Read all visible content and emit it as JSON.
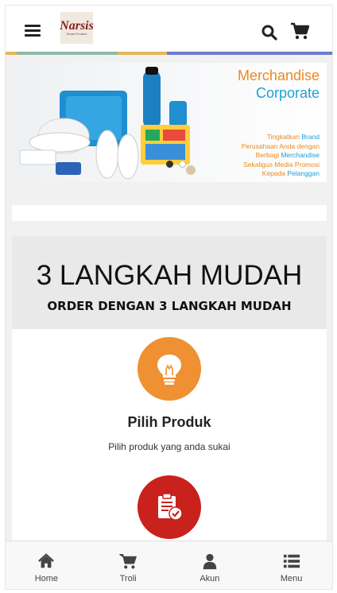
{
  "header": {
    "logo_text": "Narsis",
    "logo_sub": "Smart Product"
  },
  "banner": {
    "title_line1": "Merchandise",
    "title_line2": "Corporate",
    "tagline": [
      {
        "text": "Tingkatkan ",
        "hl": "Brand"
      },
      {
        "text": "Perusahaan Anda dengan",
        "hl": ""
      },
      {
        "text": "Berbagi ",
        "hl": "Merchandise"
      },
      {
        "text": "Sekaligus Media Promosi",
        "hl": ""
      },
      {
        "text": "Kepada ",
        "hl": "Pelanggan"
      }
    ],
    "slides": 2,
    "active_slide": 1
  },
  "steps": {
    "heading": "3 LANGKAH MUDAH",
    "subheading": "ORDER DENGAN 3 LANGKAH MUDAH",
    "items": [
      {
        "title": "Pilih Produk",
        "desc": "Pilih produk yang anda sukai",
        "icon": "lightbulb-icon",
        "color": "#ef9032"
      },
      {
        "title": "",
        "desc": "",
        "icon": "clipboard-check-icon",
        "color": "#c9221c"
      }
    ]
  },
  "bottom_nav": {
    "home": "Home",
    "troli": "Troli",
    "akun": "Akun",
    "menu": "Menu"
  },
  "colors": {
    "stripe": [
      "#e2b95a",
      "#8fb9a8",
      "#a9c6c0",
      "#e2b95a",
      "#6e7ccd",
      "#9aa6e0"
    ]
  }
}
